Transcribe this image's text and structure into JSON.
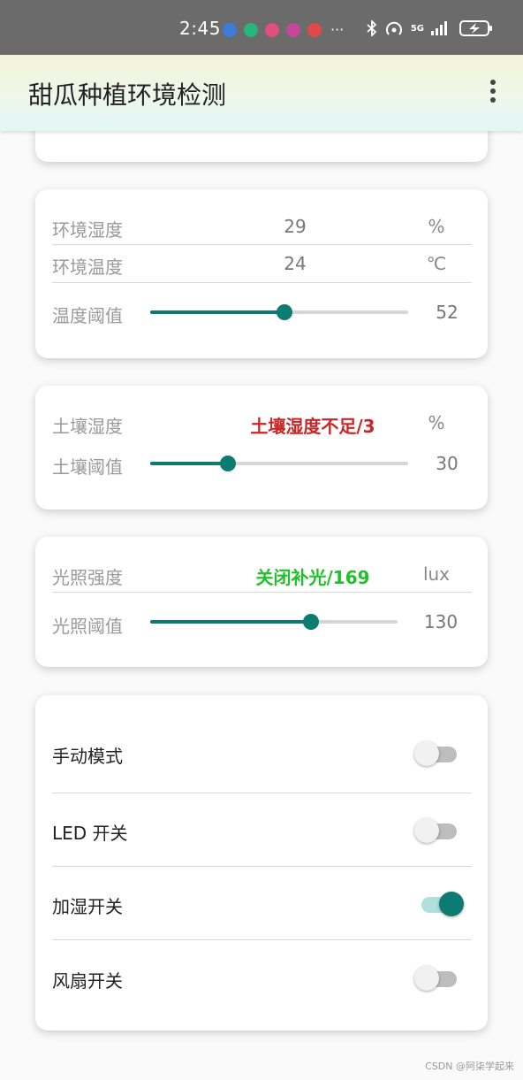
{
  "status_bar": {
    "time": "2:45",
    "notification_icons": [
      {
        "name": "usb-icon",
        "color": "#3f7bd9"
      },
      {
        "name": "vpn-shield-icon",
        "color": "#27b57a"
      },
      {
        "name": "app-lele-icon",
        "color": "#e0507a"
      },
      {
        "name": "app-pink-icon",
        "color": "#c4479b"
      },
      {
        "name": "app-book-icon",
        "color": "#e34848"
      }
    ],
    "more": "···",
    "network": "5G"
  },
  "app_bar": {
    "title": "甜瓜种植环境检测"
  },
  "air_card": {
    "humidity": {
      "label": "环境湿度",
      "value": "29",
      "unit": "%"
    },
    "temperature": {
      "label": "环境温度",
      "value": "24",
      "unit": "℃"
    },
    "temp_threshold": {
      "label": "温度阈值",
      "value": "52",
      "fraction": 0.52
    }
  },
  "soil_card": {
    "soil_humidity": {
      "label": "土壤湿度",
      "value": "土壤湿度不足/3",
      "unit": "%",
      "value_color": "#c62828"
    },
    "soil_threshold": {
      "label": "土壤阈值",
      "value": "30",
      "fraction": 0.3
    }
  },
  "light_card": {
    "light_intensity": {
      "label": "光照强度",
      "value": "关闭补光/169",
      "unit": "lux",
      "value_color": "#22c02a"
    },
    "light_threshold": {
      "label": "光照阈值",
      "value": "130",
      "fraction": 0.65
    }
  },
  "switches": [
    {
      "label": "手动模式",
      "on": false
    },
    {
      "label": "LED 开关",
      "on": false
    },
    {
      "label": "加湿开关",
      "on": true
    },
    {
      "label": "风扇开关",
      "on": false
    }
  ],
  "watermark": "CSDN @阿柒学起来"
}
